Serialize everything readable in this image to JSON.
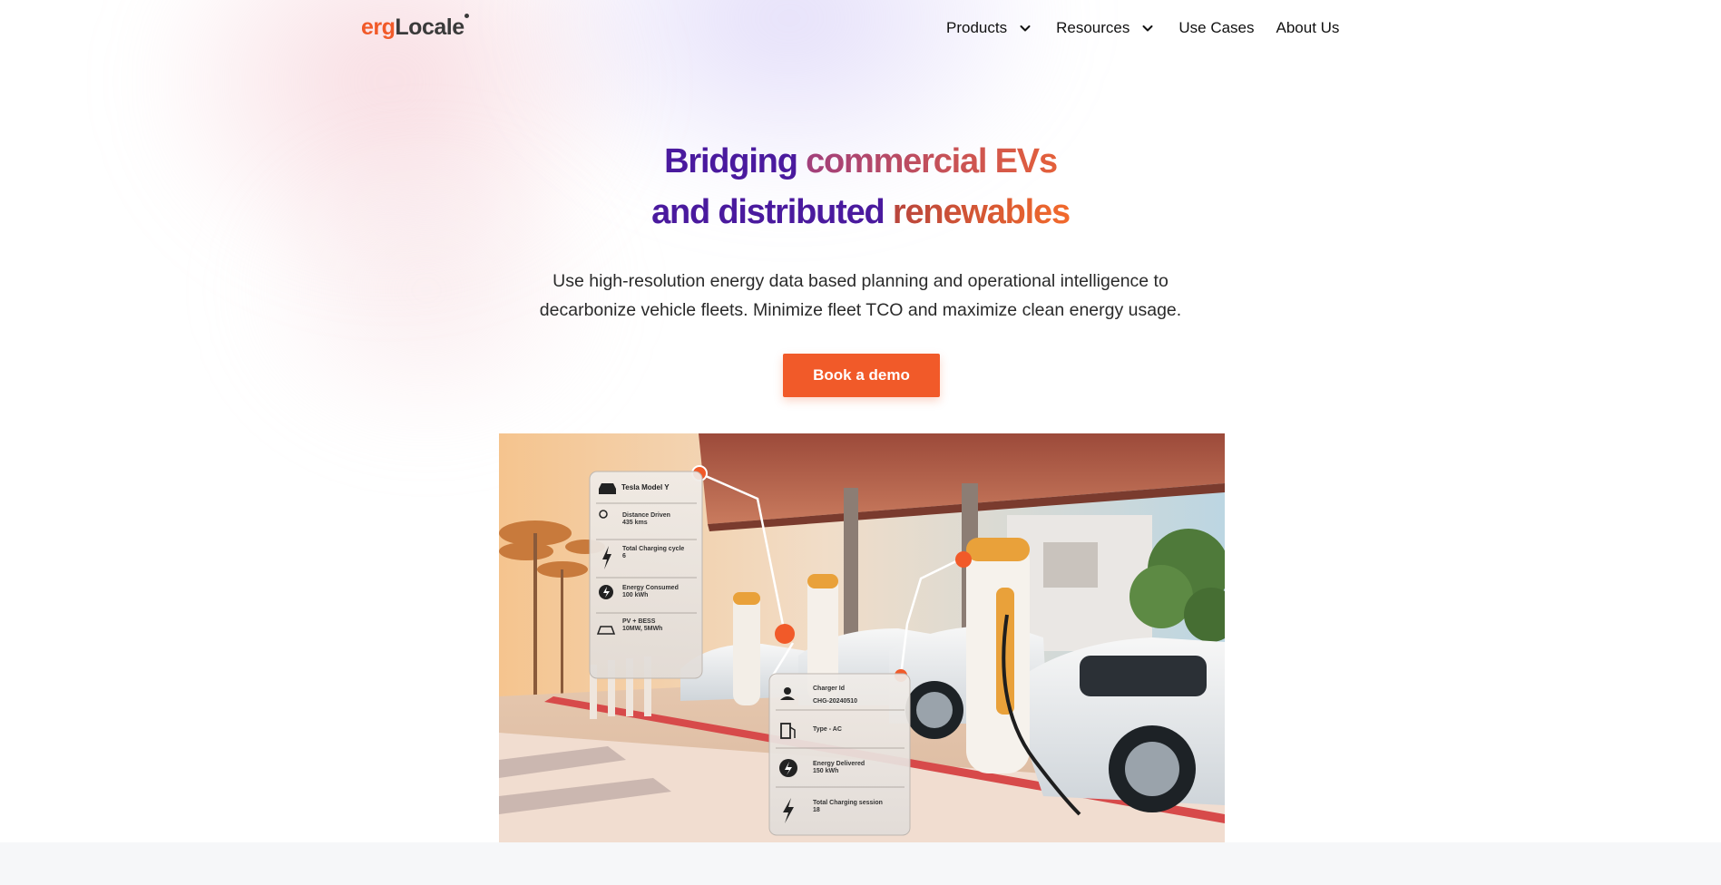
{
  "brand": {
    "logo_part1": "erg",
    "logo_part2": "Locale",
    "accent": "#f15a29",
    "purple": "#4a1a9e"
  },
  "nav": {
    "items": [
      {
        "label": "Products",
        "icon": "chevron-down-icon"
      },
      {
        "label": "Resources",
        "icon": "chevron-down-icon"
      },
      {
        "label": "Use Cases"
      },
      {
        "label": "About Us"
      }
    ]
  },
  "hero": {
    "headline_line1_part1": "Bridging",
    "headline_line1_part2": "commercial EVs",
    "headline_line2_part1": "and distributed",
    "headline_line2_part2": "renewables",
    "subtitle_line1": "Use high-resolution energy data based planning and operational intelligence to",
    "subtitle_line2": "decarbonize vehicle fleets. Minimize fleet TCO and maximize clean energy usage.",
    "cta_label": "Book a demo"
  },
  "vehicle_card": {
    "title": "Tesla Model Y",
    "distance_label": "Distance Driven",
    "distance_value": "435 kms",
    "cycles_label": "Total Charging cycle",
    "cycles_value": "6",
    "energy_label": "Energy Consumed",
    "energy_value": "100 kWh",
    "pv_label": "PV + BESS",
    "pv_value": "10MW, 5MWh"
  },
  "charger_card": {
    "id_label": "Charger Id",
    "id_value": "CHG-20240510",
    "type_label": "Type - AC",
    "delivered_label": "Energy Delivered",
    "delivered_value": "150 kWh",
    "sessions_label": "Total Charging session",
    "sessions_value": "18"
  }
}
